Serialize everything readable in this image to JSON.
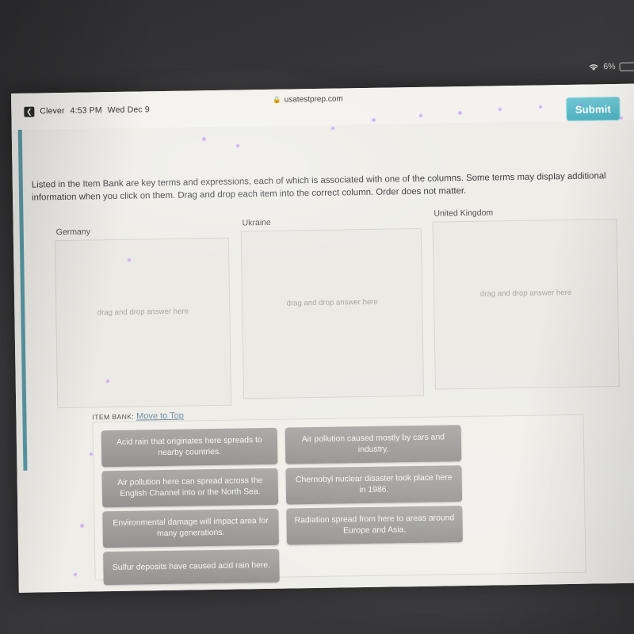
{
  "status_bar": {
    "back_icon": "back-arrow-icon",
    "app_name": "Clever",
    "time": "4:53 PM",
    "date": "Wed Dec 9",
    "lock_icon": "lock-icon",
    "url": "usatestprep.com",
    "wifi_icon": "wifi-icon",
    "battery_percent": "6%",
    "battery_icon": "battery-icon"
  },
  "toolbar": {
    "submit_label": "Submit"
  },
  "instructions": {
    "text": "Listed in the Item Bank are key terms and expressions, each of which is associated with one of the columns. Some terms may display additional information when you click on them. Drag and drop each item into the correct column. Order does not matter."
  },
  "columns": [
    {
      "label": "Germany",
      "placeholder": "drag and drop answer here"
    },
    {
      "label": "Ukraine",
      "placeholder": "drag and drop answer here"
    },
    {
      "label": "United Kingdom",
      "placeholder": "drag and drop answer here"
    }
  ],
  "item_bank": {
    "label": "ITEM BANK:",
    "move_to_top_link": "Move to Top",
    "items": [
      "Acid rain that originates here spreads to nearby countries.",
      "Air pollution caused mostly by cars and industry.",
      "Air pollution here can spread across the English Channel into or the North Sea.",
      "Chernobyl nuclear disaster took place here in 1986.",
      "Environmental damage will impact area for many generations.",
      "Radiation spread from here to areas around Europe and Asia.",
      "Sulfur deposits have caused acid rain here."
    ]
  },
  "colors": {
    "submit_button": "#4eb2c0",
    "left_rail": "#3f8a9b",
    "item_tile": "#9e9d9a",
    "link": "#6e8fa8",
    "page_background": "#eeede8"
  }
}
